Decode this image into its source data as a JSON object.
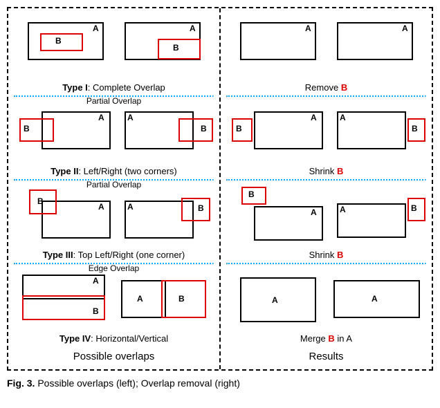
{
  "columns": {
    "left_footer": "Possible overlaps",
    "right_footer": "Results"
  },
  "rows": {
    "type1": {
      "title_prefix": "Type I",
      "title_rest": ": Complete Overlap",
      "result_action": "Remove ",
      "result_target": "B"
    },
    "type2": {
      "subtitle": "Partial Overlap",
      "title_prefix": "Type II",
      "title_rest": ": Left/Right (two corners)",
      "result_action": "Shrink ",
      "result_target": "B"
    },
    "type3": {
      "subtitle": "Partial Overlap",
      "title_prefix": "Type III",
      "title_rest": ": Top Left/Right (one corner)",
      "result_action": "Shrink ",
      "result_target": "B"
    },
    "type4": {
      "subtitle": "Edge Overlap",
      "title_prefix": "Type IV",
      "title_rest": ": Horizontal/Vertical",
      "result_action_pre": "Merge ",
      "result_target": "B",
      "result_action_post": " in A"
    }
  },
  "labels": {
    "A": "A",
    "B": "B"
  },
  "caption_prefix": "Fig. 3. ",
  "caption_rest": "Possible overlaps (left); Overlap removal (right)"
}
